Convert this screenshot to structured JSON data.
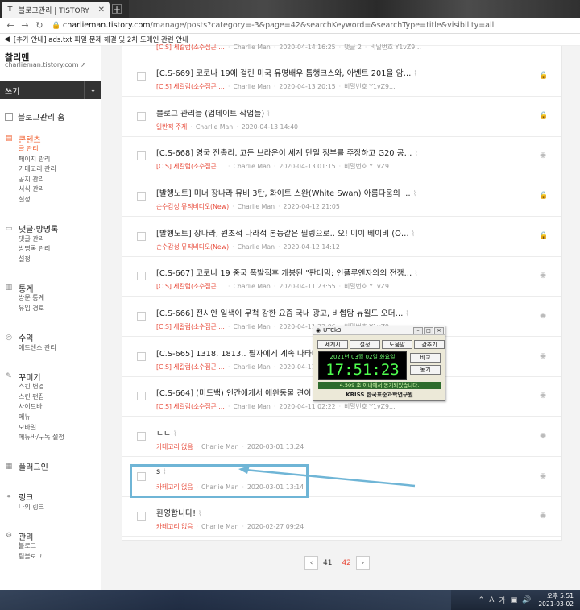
{
  "browser": {
    "tab_title": "블로그관리 | TISTORY",
    "tab_favicon": "T",
    "new_tab": "+",
    "url_host": "charlieman.tistory.com",
    "url_rest": "/manage/posts?category=-3&page=42&searchKeyword=&searchType=title&visibility=all",
    "notice": "[추가 안내] ads.txt 파일 문제 해결 및 2차 도메인 관련 안내"
  },
  "sidebar": {
    "blog_name": "찰리맨",
    "blog_url": "charlieman.tistory.com",
    "write_label": "쓰기",
    "home_label": "블로그관리 홈",
    "sections": [
      {
        "title": "콘텐츠",
        "icon": "document-icon",
        "active": true,
        "items": [
          "글 관리",
          "페이지 관리",
          "카테고리 관리",
          "공지 관리",
          "서식 관리",
          "설정"
        ]
      },
      {
        "title": "댓글·방명록",
        "icon": "comment-icon",
        "active": false,
        "items": [
          "댓글 관리",
          "방명록 관리",
          "설정"
        ]
      },
      {
        "title": "통계",
        "icon": "chart-icon",
        "active": false,
        "items": [
          "방문 통계",
          "유입 경로"
        ]
      },
      {
        "title": "수익",
        "icon": "money-icon",
        "active": false,
        "items": [
          "애드센스 관리"
        ]
      },
      {
        "title": "꾸미기",
        "icon": "brush-icon",
        "active": false,
        "items": [
          "스킨 변경",
          "스킨 편집",
          "사이드바",
          "메뉴",
          "모바일",
          "메뉴바/구독 설정"
        ]
      },
      {
        "title": "플러그인",
        "icon": "plugin-icon",
        "active": false,
        "items": []
      },
      {
        "title": "링크",
        "icon": "link-icon",
        "active": false,
        "items": [
          "나의 링크"
        ]
      },
      {
        "title": "관리",
        "icon": "settings-icon",
        "active": false,
        "items": [
          "블로그",
          "팀블로그"
        ]
      }
    ]
  },
  "posts": [
    {
      "title": "",
      "category": "[C.S] 세칼럼(소수점근 …",
      "author": "Charlie Man",
      "date": "2020-04-14 16:25",
      "extra": "댓글 2",
      "status": "비밀번호 Y1vZ9…",
      "icon": "eye-icon"
    },
    {
      "title": "[C.S-669] 코로나 19에 걸린 미국 유명배우 톰행크스와, 아벤트 201을 암…",
      "category": "[C.S] 세칼럼(소수점근 …",
      "author": "Charlie Man",
      "date": "2020-04-13 20:15",
      "extra": "",
      "status": "비밀번호 Y1vZ9…",
      "icon": "lock-icon"
    },
    {
      "title": "블로그 관리들 (업데이트 작업들)",
      "category": "일반적 주제",
      "author": "Charlie Man",
      "date": "2020-04-13 14:40",
      "extra": "",
      "status": "",
      "icon": "lock-icon"
    },
    {
      "title": "[C.S-668] 영국 전총리, 고든 브라운이 세계 단일 정부를 주장하고 G20 공…",
      "category": "[C.S] 세칼럼(소수점근 …",
      "author": "Charlie Man",
      "date": "2020-04-13 01:15",
      "extra": "",
      "status": "비밀번호 Y1vZ9…",
      "icon": "eye-icon"
    },
    {
      "title": "[발행노트] 미너 장나라 뮤비 3탄, 화이트 스완(White Swan) 아름다움의 …",
      "category": "순수감성 뮤직비디오(New)",
      "author": "Charlie Man",
      "date": "2020-04-12 21:05",
      "extra": "",
      "status": "",
      "icon": "lock-icon"
    },
    {
      "title": "[발행노트] 장나라, 원초적 나라적 본능같은 필링으로.. 오! 미이 베이비 (O…",
      "category": "순수감성 뮤직비디오(New)",
      "author": "Charlie Man",
      "date": "2020-04-12 14:12",
      "extra": "",
      "status": "",
      "icon": "lock-icon"
    },
    {
      "title": "[C.S-667] 코로나 19 중국 폭발직후 개봉된 \"판데믹: 인플루엔자와의 전쟁…",
      "category": "[C.S] 세칼럼(소수점근 …",
      "author": "Charlie Man",
      "date": "2020-04-11 23:55",
      "extra": "",
      "status": "비밀번호 Y1vZ9…",
      "icon": "eye-icon"
    },
    {
      "title": "[C.S-666] 전시안 일색이 무척 강한 요즘 국내 광고, 비썹탐 뉴월드 오더…",
      "category": "[C.S] 세칼럼(소수점근 …",
      "author": "Charlie Man",
      "date": "2020-04-11 22:06",
      "extra": "",
      "status": "비밀번호 Y1vZ9…",
      "icon": "eye-icon"
    },
    {
      "title": "[C.S-665] 1318, 1813.. 필자에게 계속 나타나는 ",
      "category": "[C.S] 세칼럼(소수점근 …",
      "author": "Charlie Man",
      "date": "2020-04-11 21:51",
      "extra": "",
      "status": "",
      "icon": "eye-icon"
    },
    {
      "title": "[C.S-664] (미드백) 인간에게서 애완동물 견이 코로",
      "category": "[C.S] 세칼럼(소수점근 …",
      "author": "Charlie Man",
      "date": "2020-04-11 02:22",
      "extra": "",
      "status": "비밀번호 Y1vZ9…",
      "icon": "eye-icon"
    },
    {
      "title": "ㄴㄴ",
      "category": "카테고리 없음",
      "author": "Charlie Man",
      "date": "2020-03-01 13:24",
      "extra": "",
      "status": "",
      "icon": "eye-icon"
    },
    {
      "title": "s",
      "category": "카테고리 없음",
      "author": "Charlie Man",
      "date": "2020-03-01 13:14",
      "extra": "",
      "status": "",
      "icon": "eye-icon"
    },
    {
      "title": "환영합니다!",
      "category": "카테고리 없음",
      "author": "Charlie Man",
      "date": "2020-02-27 09:24",
      "extra": "",
      "status": "",
      "icon": "eye-icon"
    }
  ],
  "pager": {
    "prev": "‹",
    "next": "›",
    "pages": [
      "41",
      "42"
    ],
    "current": "42"
  },
  "utck": {
    "title": "UTCk3",
    "buttons": [
      "세계시",
      "설정",
      "도움말",
      "감추기"
    ],
    "date": "2021년 03월 02일 화요일",
    "time": "17:51:23",
    "side_buttons": [
      "비교",
      "동기"
    ],
    "status": "4.509 초 이내에서 동기되었습니다.",
    "org": "KRISS 한국표준과학연구원"
  },
  "taskbar": {
    "time": "오후 5:51",
    "date": "2021-03-02",
    "ime": "A",
    "ime2": "가"
  },
  "colors": {
    "accent": "#f05a28",
    "category": "#e84d3d",
    "highlight": "#6fb5d6"
  }
}
